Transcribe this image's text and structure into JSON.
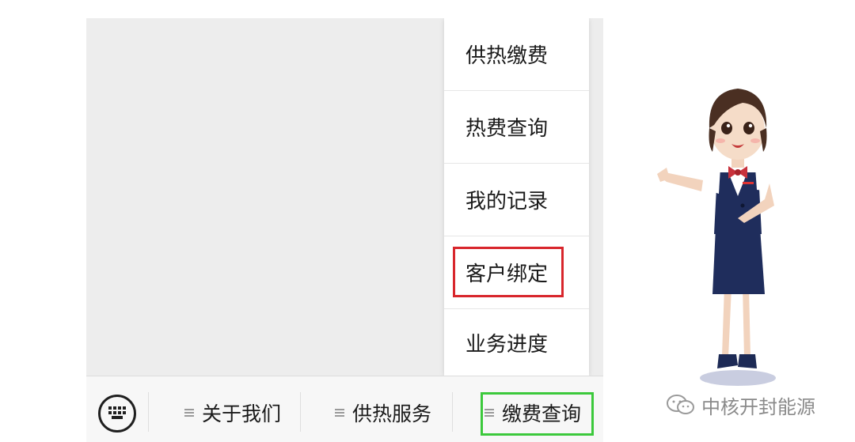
{
  "menu": {
    "items": [
      {
        "label": "供热缴费"
      },
      {
        "label": "热费查询"
      },
      {
        "label": "我的记录"
      },
      {
        "label": "客户绑定"
      },
      {
        "label": "业务进度"
      }
    ]
  },
  "bottom_bar": {
    "keyboard_icon": "keyboard-icon",
    "tabs": [
      {
        "label": "关于我们"
      },
      {
        "label": "供热服务"
      },
      {
        "label": "缴费查询"
      }
    ]
  },
  "watermark": {
    "text": "中核开封能源",
    "icon": "wechat-icon"
  },
  "colors": {
    "red_highlight": "#d8262c",
    "green_highlight": "#3cc93c"
  }
}
